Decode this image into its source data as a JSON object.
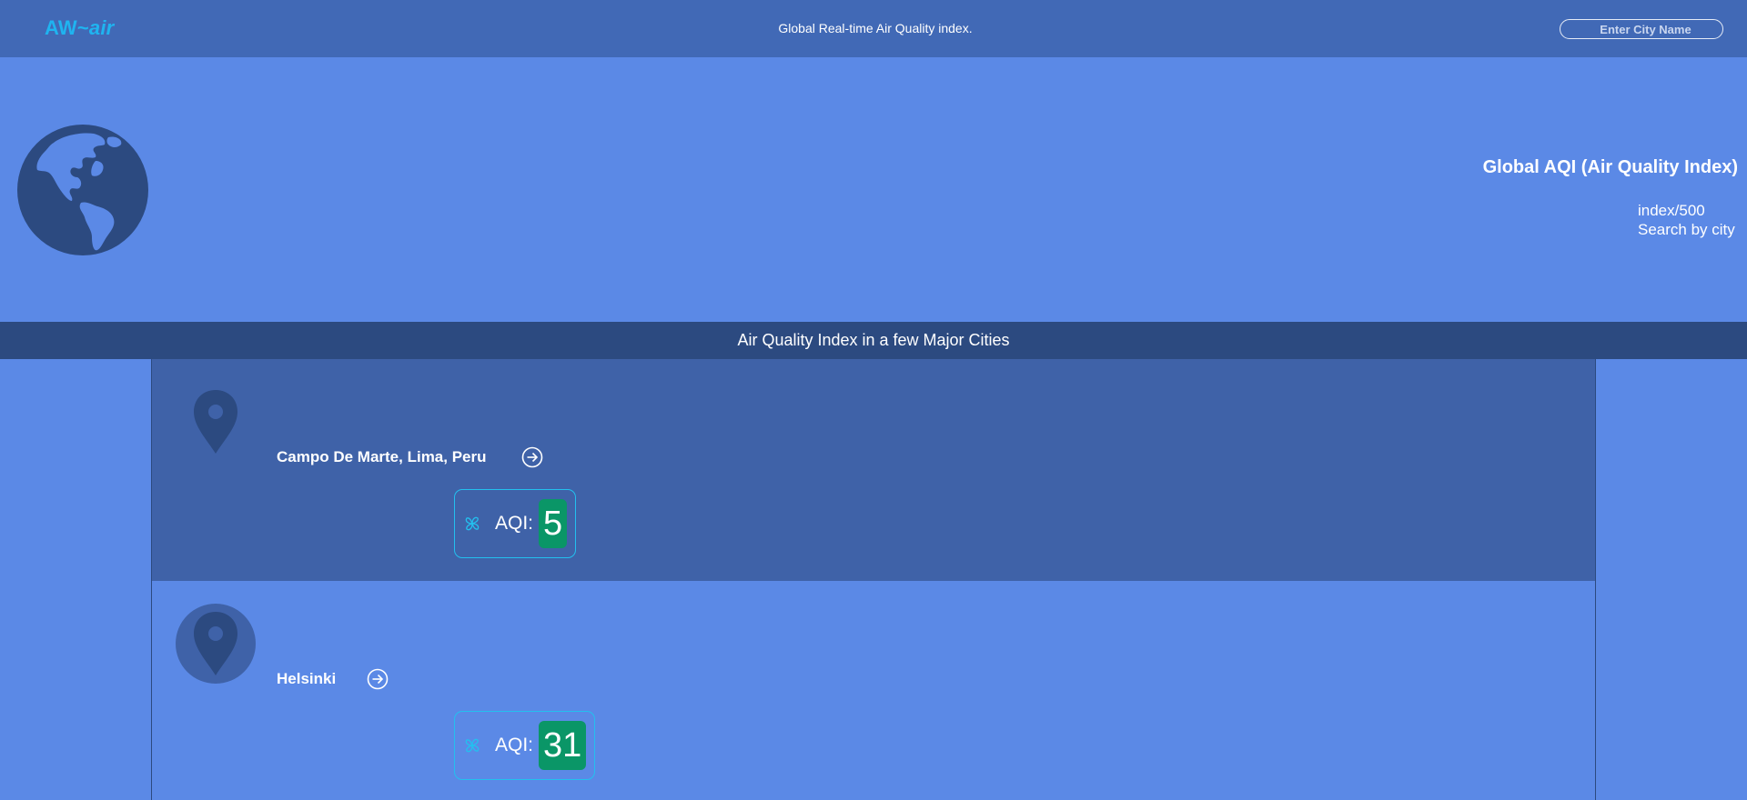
{
  "header": {
    "brand_main": "AW~",
    "brand_accent": "air",
    "tagline": "Global Real-time Air Quality index.",
    "search_placeholder": "Enter City Name",
    "search_icon": "magnifier-icon"
  },
  "hero": {
    "globe_icon": "globe-americas-icon",
    "title": "Global AQI (Air Quality Index)",
    "line1": "index/500",
    "line2": "Search by city"
  },
  "section": {
    "title": "Air Quality Index in a few Major Cities"
  },
  "cities": [
    {
      "name": "Campo De Marte, Lima, Peru",
      "aqi_label": "AQI:",
      "aqi": "5",
      "aqi_color": "#0a9667"
    },
    {
      "name": "Helsinki",
      "aqi_label": "AQI:",
      "aqi": "31",
      "aqi_color": "#0a9667"
    }
  ],
  "colors": {
    "nav": "#4169b6",
    "page": "#5b89e6",
    "bar": "#2c4a80",
    "brand": "#1fb4f0",
    "aqi_border": "#23c0ef"
  }
}
